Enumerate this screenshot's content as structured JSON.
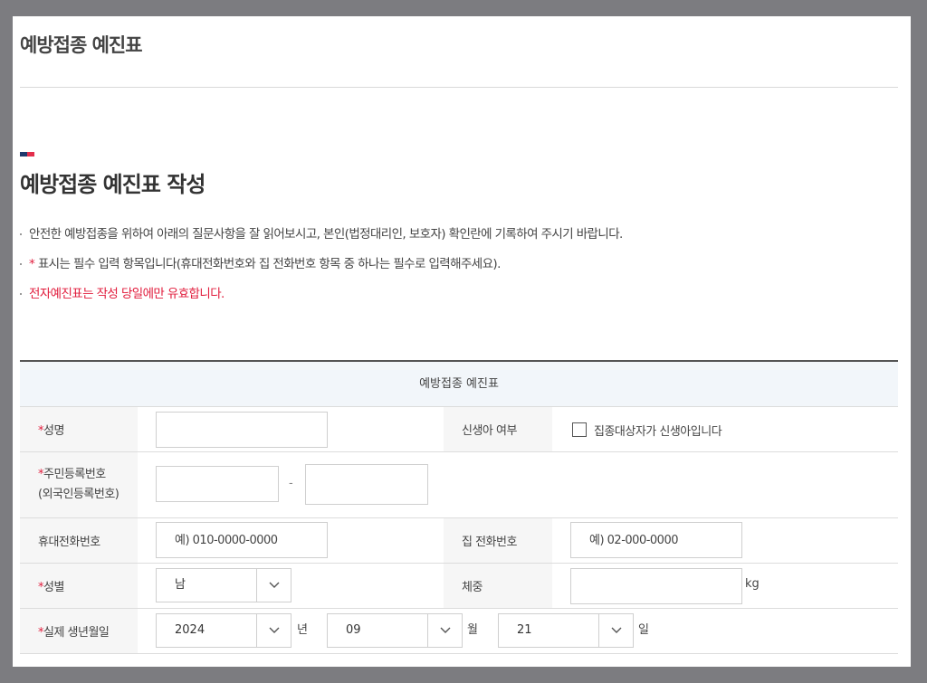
{
  "page": {
    "title": "예방접종 예진표"
  },
  "section": {
    "title": "예방접종 예진표 작성"
  },
  "notes": {
    "n1": "안전한 예방접종을 위하여 아래의 질문사항을 잘 읽어보시고, 본인(법정대리인, 보호자) 확인란에 기록하여 주시기 바랍니다.",
    "n2_star": "*",
    "n2": " 표시는 필수 입력 항목입니다(휴대전화번호와 집 전화번호 항목 중 하나는 필수로 입력해주세요).",
    "n3": "전자예진표는 작성 당일에만 유효합니다."
  },
  "colors": {
    "accent_navy": "#1f3b6e",
    "accent_red": "#e32e4b",
    "required": "#e11c3c"
  },
  "form": {
    "caption": "예방접종 예진표",
    "required_mark": "*",
    "name": {
      "label": "성명",
      "value": ""
    },
    "newborn": {
      "label": "신생아 여부",
      "checkbox_label": "집종대상자가 신생아입니다",
      "checked": false
    },
    "resident": {
      "label_line1": "주민등록번호",
      "label_line2": "(외국인등록번호)",
      "dash": "-",
      "front": "",
      "back": ""
    },
    "mobile": {
      "label": "휴대전화번호",
      "placeholder": "예) 010-0000-0000"
    },
    "home_phone": {
      "label": "집 전화번호",
      "placeholder": "예) 02-000-0000"
    },
    "gender": {
      "label": "성별",
      "value": "남",
      "icon": "chevron-down-icon"
    },
    "weight": {
      "label": "체중",
      "value": "",
      "unit": "kg"
    },
    "birth": {
      "label": "실제 생년월일",
      "year": "2024",
      "year_unit": "년",
      "month": "09",
      "month_unit": "월",
      "day": "21",
      "day_unit": "일"
    }
  }
}
